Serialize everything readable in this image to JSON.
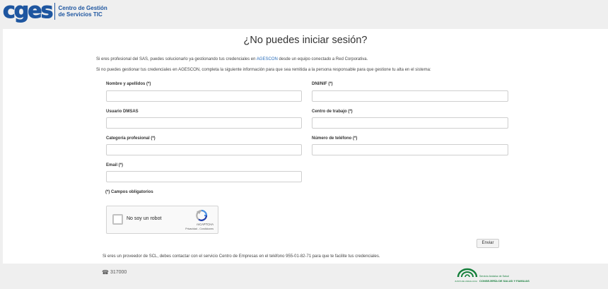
{
  "brand": {
    "logo_text": "cges",
    "line1": "Centro de Gestión",
    "line2": "de Servicios TIC"
  },
  "page": {
    "title": "¿No puedes iniciar sesión?",
    "intro1_before": "Si eres profesional del SAS, puedes solucionarlo ya gestionando tus credenciales en",
    "intro1_link": "AGESCON",
    "intro1_after": "desde un equipo conectado a Red Corporativa.",
    "intro2": "Si no puedes gestionar tus credenciales en AGESCON, completa la siguiente información para que sea remitida a la persona responsable para que gestione tu alta en el sistema:"
  },
  "form": {
    "nombre_label": "Nombre y apellidos (*)",
    "dni_label": "DNI/NIF (*)",
    "usuario_label": "Usuario DMSAS",
    "centro_label": "Centro de trabajo (*)",
    "categoria_label": "Categoría profesional (*)",
    "telefono_label": "Número de teléfono (*)",
    "email_label": "Email (*)",
    "required_note": "(*) Campos obligatorios",
    "submit_label": "Enviar"
  },
  "captcha": {
    "label": "No soy un robot",
    "brand": "reCAPTCHA",
    "links": "Privacidad - Condiciones"
  },
  "provider_note": "Si eres un proveedor de SCL, debes contactar con el servicio Centro de Empresas en el teléfono 955-01-82-71 para que te facilite tus credenciales.",
  "footer": {
    "phone": "317000",
    "logo_small": "JUNTA DE ANDALUCIA",
    "logo_line1": "Servicio Andaluz de Salud",
    "logo_line2": "CONSEJERÍA DE SALUD Y FAMILIAS"
  },
  "colors": {
    "brand_blue": "#1e56a0",
    "link_blue": "#2a6ebb",
    "junta_green": "#157f3b"
  }
}
